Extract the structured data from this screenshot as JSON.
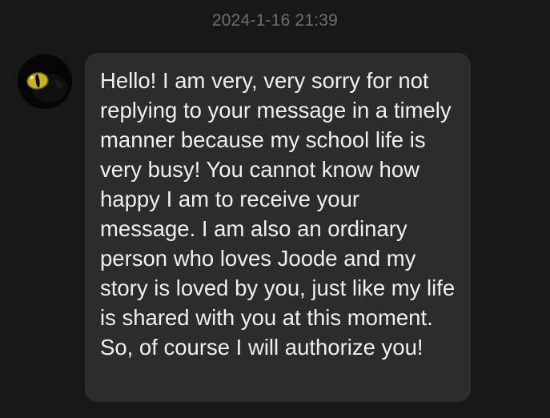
{
  "chat": {
    "timestamp": "2024-1-16 21:39",
    "messages": [
      {
        "sender": "contact",
        "avatar_icon": "cat-eye-avatar-icon",
        "text": "Hello! I am very, very sorry for not replying to your message in a timely manner because my school life is very busy! You cannot know how happy I am to receive your message. I am also an ordinary person who loves Joode and my story is loved by you, just like my life is shared with you at this moment. So, of course I will authorize you!"
      }
    ]
  },
  "colors": {
    "background": "#181818",
    "bubble": "#2c2c2c",
    "text": "#efefef",
    "timestamp": "#6f6f6f",
    "avatar_eye": "#c9b226"
  }
}
